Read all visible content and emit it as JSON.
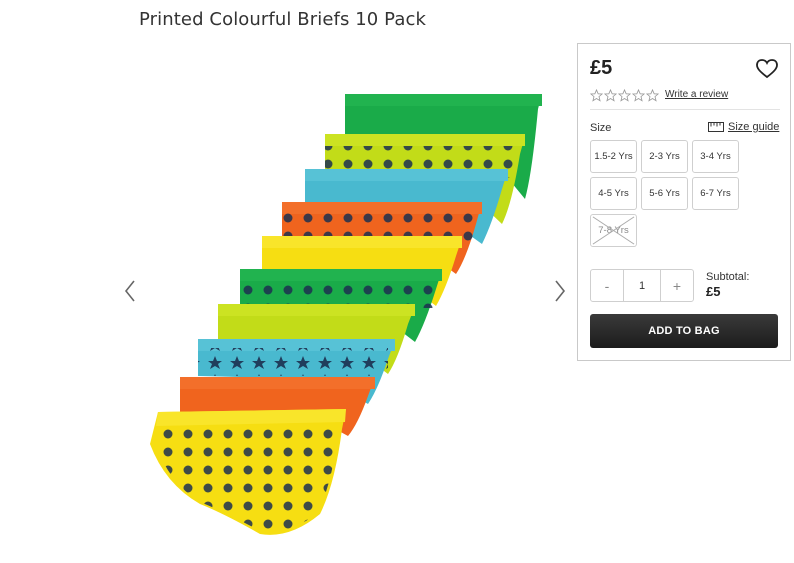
{
  "product": {
    "title": "Printed Colourful Briefs 10 Pack",
    "image_icon": "product-briefs-image"
  },
  "gallery": {
    "prev_icon": "chevron-left-icon",
    "next_icon": "chevron-right-icon"
  },
  "purchase": {
    "price": "£5",
    "rating_stars": 0,
    "rating_max": 5,
    "write_review": "Write a review",
    "size_label": "Size",
    "size_guide_label": "Size guide",
    "sizes": [
      {
        "label": "1.5-2 Yrs",
        "available": true
      },
      {
        "label": "2-3 Yrs",
        "available": true
      },
      {
        "label": "3-4 Yrs",
        "available": true
      },
      {
        "label": "4-5 Yrs",
        "available": true
      },
      {
        "label": "5-6 Yrs",
        "available": true
      },
      {
        "label": "6-7 Yrs",
        "available": true
      },
      {
        "label": "7-8 Yrs",
        "available": false
      }
    ],
    "quantity": {
      "minus": "-",
      "value": "1",
      "plus": "+"
    },
    "subtotal_label": "Subtotal:",
    "subtotal_value": "£5",
    "add_to_bag": "ADD TO BAG"
  },
  "colors": {
    "button_dark": "#1f1f1f",
    "green": "#1aab49",
    "lime": "#c2dc18",
    "blue": "#49b9cf",
    "orange": "#f0641e",
    "yellow": "#f6de12"
  }
}
